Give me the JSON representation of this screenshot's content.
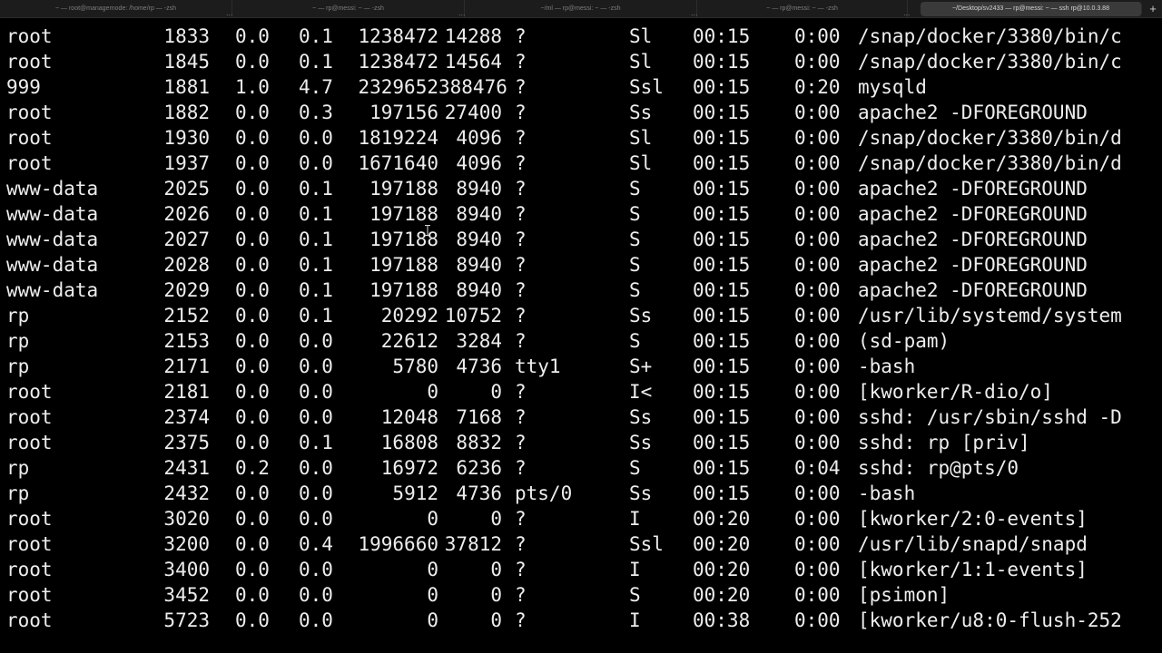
{
  "tabs": [
    {
      "title": "~ — root@managernode: /home/rp — -zsh",
      "active": false
    },
    {
      "title": "~ — rp@messi: ~ — -zsh",
      "active": false
    },
    {
      "title": "~/ml — rp@messi: ~ — -zsh",
      "active": false
    },
    {
      "title": "~ — rp@messi: ~ — -zsh",
      "active": false
    },
    {
      "title": "~/Desktop/sv2433 — rp@messi: ~ — ssh rp@10.0.3.88",
      "active": true
    }
  ],
  "tab_more_label": "...",
  "new_tab_label": "+",
  "processes": [
    {
      "user": "root",
      "pid": "1833",
      "cpu": "0.0",
      "mem": "0.1",
      "vsz": "1238472",
      "rss": "14288",
      "tty": "?",
      "stat": "Sl",
      "start": "00:15",
      "time": "0:00",
      "command": "/snap/docker/3380/bin/c"
    },
    {
      "user": "root",
      "pid": "1845",
      "cpu": "0.0",
      "mem": "0.1",
      "vsz": "1238472",
      "rss": "14564",
      "tty": "?",
      "stat": "Sl",
      "start": "00:15",
      "time": "0:00",
      "command": "/snap/docker/3380/bin/c"
    },
    {
      "user": "999",
      "pid": "1881",
      "cpu": "1.0",
      "mem": "4.7",
      "vsz": "2329652",
      "rss": "388476",
      "tty": "?",
      "stat": "Ssl",
      "start": "00:15",
      "time": "0:20",
      "command": "mysqld"
    },
    {
      "user": "root",
      "pid": "1882",
      "cpu": "0.0",
      "mem": "0.3",
      "vsz": "197156",
      "rss": "27400",
      "tty": "?",
      "stat": "Ss",
      "start": "00:15",
      "time": "0:00",
      "command": "apache2 -DFOREGROUND"
    },
    {
      "user": "root",
      "pid": "1930",
      "cpu": "0.0",
      "mem": "0.0",
      "vsz": "1819224",
      "rss": "4096",
      "tty": "?",
      "stat": "Sl",
      "start": "00:15",
      "time": "0:00",
      "command": "/snap/docker/3380/bin/d"
    },
    {
      "user": "root",
      "pid": "1937",
      "cpu": "0.0",
      "mem": "0.0",
      "vsz": "1671640",
      "rss": "4096",
      "tty": "?",
      "stat": "Sl",
      "start": "00:15",
      "time": "0:00",
      "command": "/snap/docker/3380/bin/d"
    },
    {
      "user": "www-data",
      "pid": "2025",
      "cpu": "0.0",
      "mem": "0.1",
      "vsz": "197188",
      "rss": "8940",
      "tty": "?",
      "stat": "S",
      "start": "00:15",
      "time": "0:00",
      "command": "apache2 -DFOREGROUND"
    },
    {
      "user": "www-data",
      "pid": "2026",
      "cpu": "0.0",
      "mem": "0.1",
      "vsz": "197188",
      "rss": "8940",
      "tty": "?",
      "stat": "S",
      "start": "00:15",
      "time": "0:00",
      "command": "apache2 -DFOREGROUND"
    },
    {
      "user": "www-data",
      "pid": "2027",
      "cpu": "0.0",
      "mem": "0.1",
      "vsz": "197188",
      "rss": "8940",
      "tty": "?",
      "stat": "S",
      "start": "00:15",
      "time": "0:00",
      "command": "apache2 -DFOREGROUND"
    },
    {
      "user": "www-data",
      "pid": "2028",
      "cpu": "0.0",
      "mem": "0.1",
      "vsz": "197188",
      "rss": "8940",
      "tty": "?",
      "stat": "S",
      "start": "00:15",
      "time": "0:00",
      "command": "apache2 -DFOREGROUND"
    },
    {
      "user": "www-data",
      "pid": "2029",
      "cpu": "0.0",
      "mem": "0.1",
      "vsz": "197188",
      "rss": "8940",
      "tty": "?",
      "stat": "S",
      "start": "00:15",
      "time": "0:00",
      "command": "apache2 -DFOREGROUND"
    },
    {
      "user": "rp",
      "pid": "2152",
      "cpu": "0.0",
      "mem": "0.1",
      "vsz": "20292",
      "rss": "10752",
      "tty": "?",
      "stat": "Ss",
      "start": "00:15",
      "time": "0:00",
      "command": "/usr/lib/systemd/system"
    },
    {
      "user": "rp",
      "pid": "2153",
      "cpu": "0.0",
      "mem": "0.0",
      "vsz": "22612",
      "rss": "3284",
      "tty": "?",
      "stat": "S",
      "start": "00:15",
      "time": "0:00",
      "command": "(sd-pam)"
    },
    {
      "user": "rp",
      "pid": "2171",
      "cpu": "0.0",
      "mem": "0.0",
      "vsz": "5780",
      "rss": "4736",
      "tty": "tty1",
      "stat": "S+",
      "start": "00:15",
      "time": "0:00",
      "command": "-bash"
    },
    {
      "user": "root",
      "pid": "2181",
      "cpu": "0.0",
      "mem": "0.0",
      "vsz": "0",
      "rss": "0",
      "tty": "?",
      "stat": "I<",
      "start": "00:15",
      "time": "0:00",
      "command": "[kworker/R-dio/o]"
    },
    {
      "user": "root",
      "pid": "2374",
      "cpu": "0.0",
      "mem": "0.0",
      "vsz": "12048",
      "rss": "7168",
      "tty": "?",
      "stat": "Ss",
      "start": "00:15",
      "time": "0:00",
      "command": "sshd: /usr/sbin/sshd -D"
    },
    {
      "user": "root",
      "pid": "2375",
      "cpu": "0.0",
      "mem": "0.1",
      "vsz": "16808",
      "rss": "8832",
      "tty": "?",
      "stat": "Ss",
      "start": "00:15",
      "time": "0:00",
      "command": "sshd: rp [priv]"
    },
    {
      "user": "rp",
      "pid": "2431",
      "cpu": "0.2",
      "mem": "0.0",
      "vsz": "16972",
      "rss": "6236",
      "tty": "?",
      "stat": "S",
      "start": "00:15",
      "time": "0:04",
      "command": "sshd: rp@pts/0"
    },
    {
      "user": "rp",
      "pid": "2432",
      "cpu": "0.0",
      "mem": "0.0",
      "vsz": "5912",
      "rss": "4736",
      "tty": "pts/0",
      "stat": "Ss",
      "start": "00:15",
      "time": "0:00",
      "command": "-bash"
    },
    {
      "user": "root",
      "pid": "3020",
      "cpu": "0.0",
      "mem": "0.0",
      "vsz": "0",
      "rss": "0",
      "tty": "?",
      "stat": "I",
      "start": "00:20",
      "time": "0:00",
      "command": "[kworker/2:0-events]"
    },
    {
      "user": "root",
      "pid": "3200",
      "cpu": "0.0",
      "mem": "0.4",
      "vsz": "1996660",
      "rss": "37812",
      "tty": "?",
      "stat": "Ssl",
      "start": "00:20",
      "time": "0:00",
      "command": "/usr/lib/snapd/snapd"
    },
    {
      "user": "root",
      "pid": "3400",
      "cpu": "0.0",
      "mem": "0.0",
      "vsz": "0",
      "rss": "0",
      "tty": "?",
      "stat": "I",
      "start": "00:20",
      "time": "0:00",
      "command": "[kworker/1:1-events]"
    },
    {
      "user": "root",
      "pid": "3452",
      "cpu": "0.0",
      "mem": "0.0",
      "vsz": "0",
      "rss": "0",
      "tty": "?",
      "stat": "S",
      "start": "00:20",
      "time": "0:00",
      "command": "[psimon]"
    },
    {
      "user": "root",
      "pid": "5723",
      "cpu": "0.0",
      "mem": "0.0",
      "vsz": "0",
      "rss": "0",
      "tty": "?",
      "stat": "I",
      "start": "00:38",
      "time": "0:00",
      "command": "[kworker/u8:0-flush-252"
    }
  ],
  "colors": {
    "background": "#000000",
    "foreground": "#ededed",
    "tabbar": "#1c1c1c",
    "active_tab": "#3a3a3a"
  },
  "icons": {
    "cursor": "ibeam-cursor-icon"
  }
}
